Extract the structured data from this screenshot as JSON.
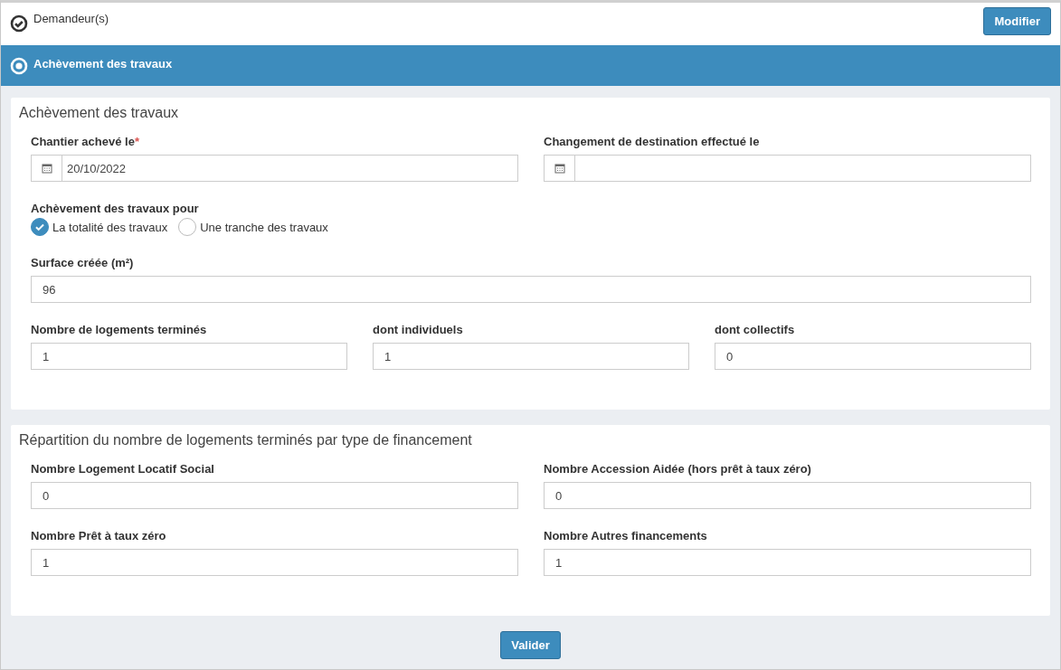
{
  "steps": [
    {
      "title": "Demandeur(s)",
      "selected": false,
      "action": "Modifier"
    },
    {
      "title": "Achèvement des travaux",
      "selected": true
    }
  ],
  "sections": [
    {
      "title": "Achèvement des travaux",
      "rows": [
        [
          {
            "kind": "date",
            "label": "Chantier achevé le",
            "required_mark": "*",
            "value": "20/10/2022"
          },
          {
            "kind": "date",
            "label": "Changement de destination effectué le"
          }
        ],
        [
          {
            "kind": "radio",
            "label": "Achèvement des travaux pour",
            "options": [
              {
                "label": "La totalité des travaux",
                "selected": true
              },
              {
                "label": "Une tranche des travaux",
                "selected": false
              }
            ]
          }
        ],
        [
          {
            "kind": "text",
            "label": "Surface créée (m²)",
            "value": "96"
          }
        ],
        [
          {
            "kind": "text",
            "label": "Nombre de logements terminés",
            "value": "1"
          },
          {
            "kind": "text",
            "label": "dont individuels",
            "value": "1"
          },
          {
            "kind": "text",
            "label": "dont collectifs",
            "value": "0"
          }
        ]
      ]
    },
    {
      "title": "Répartition du nombre de logements terminés par type de financement",
      "rows": [
        [
          {
            "kind": "text",
            "label": "Nombre Logement Locatif Social",
            "value": "0"
          },
          {
            "kind": "text",
            "label": "Nombre Accession Aidée (hors prêt à taux zéro)",
            "value": "0"
          }
        ],
        [
          {
            "kind": "text",
            "label": "Nombre Prêt à taux zéro",
            "value": "1"
          },
          {
            "kind": "text",
            "label": "Nombre Autres financements",
            "value": "1"
          }
        ]
      ]
    }
  ],
  "submit": "Valider"
}
